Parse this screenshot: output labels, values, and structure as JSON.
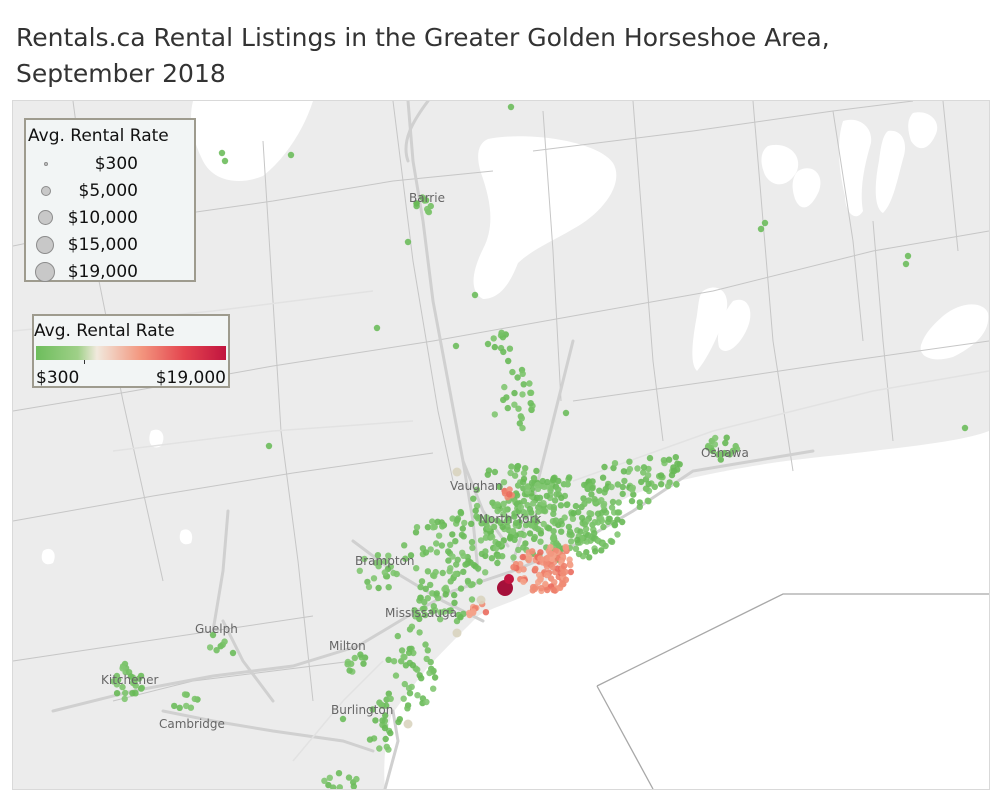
{
  "title": "Rentals.ca Rental Listings in the Greater Golden Horseshoe Area, September 2018",
  "size_legend": {
    "title": "Avg. Rental Rate",
    "items": [
      {
        "label": "$300",
        "value": 300
      },
      {
        "label": "$5,000",
        "value": 5000
      },
      {
        "label": "$10,000",
        "value": 10000
      },
      {
        "label": "$15,000",
        "value": 15000
      },
      {
        "label": "$19,000",
        "value": 19000
      }
    ]
  },
  "color_legend": {
    "title": "Avg. Rental Rate",
    "min_label": "$300",
    "max_label": "$19,000",
    "colors": [
      "#6dbd5c",
      "#9fd088",
      "#f1e9dd",
      "#f3977f",
      "#e4454f",
      "#c1143f"
    ]
  },
  "cities": [
    {
      "id": "barrie",
      "label": "Barrie"
    },
    {
      "id": "oshawa",
      "label": "Oshawa"
    },
    {
      "id": "vaughan",
      "label": "Vaughan"
    },
    {
      "id": "north-york",
      "label": "North York"
    },
    {
      "id": "brampton",
      "label": "Brampton"
    },
    {
      "id": "mississauga",
      "label": "Mississauga"
    },
    {
      "id": "guelph",
      "label": "Guelph"
    },
    {
      "id": "milton",
      "label": "Milton"
    },
    {
      "id": "kitchener",
      "label": "Kitchener"
    },
    {
      "id": "cambridge",
      "label": "Cambridge"
    },
    {
      "id": "burlington",
      "label": "Burlington"
    }
  ],
  "colors": {
    "land": "#ececec",
    "water": "#ffffff",
    "road": "#d2d2d2",
    "boundary": "#c6c6c6",
    "low_rate": "#6dbd5c",
    "high_rate": "#c1143f"
  }
}
